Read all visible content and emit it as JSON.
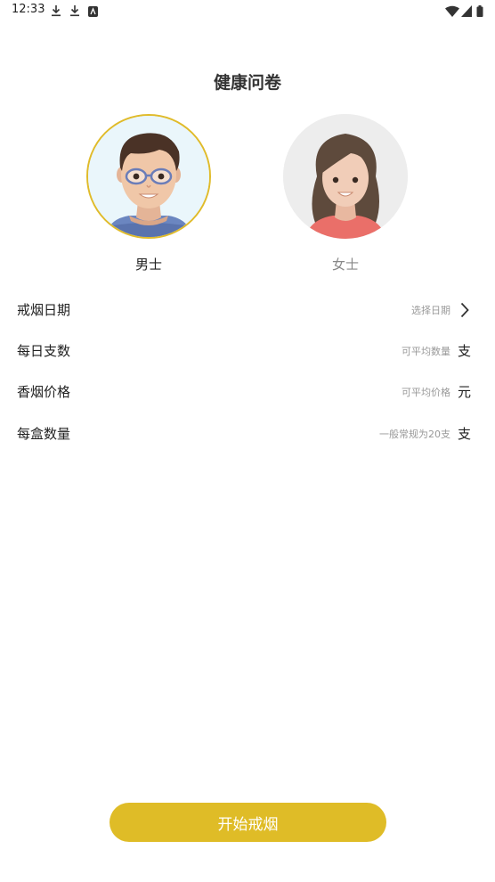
{
  "status_bar": {
    "time": "12:33",
    "left_icons": [
      "download-icon",
      "download-icon",
      "accessibility-icon"
    ],
    "right_icons": [
      "wifi-icon",
      "cell-signal-icon",
      "battery-icon"
    ]
  },
  "page": {
    "title": "健康问卷"
  },
  "gender": {
    "male": {
      "label": "男士",
      "selected": true
    },
    "female": {
      "label": "女士",
      "selected": false
    }
  },
  "form": {
    "rows": [
      {
        "label": "戒烟日期",
        "hint": "选择日期",
        "trailing": "chevron-right-icon"
      },
      {
        "label": "每日支数",
        "hint": "可平均数量",
        "unit": "支"
      },
      {
        "label": "香烟价格",
        "hint": "可平均价格",
        "unit": "元"
      },
      {
        "label": "每盒数量",
        "hint": "一般常规为20支",
        "unit": "支"
      }
    ]
  },
  "action": {
    "start_label": "开始戒烟"
  },
  "colors": {
    "accent": "#dfbc27"
  }
}
